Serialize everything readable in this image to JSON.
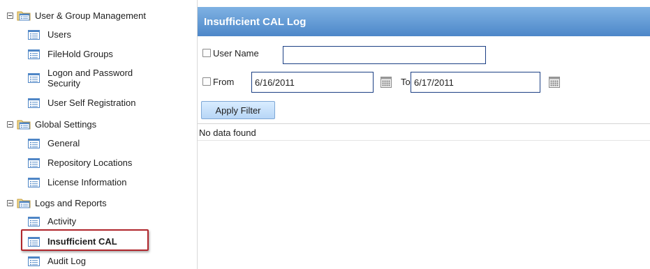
{
  "sidebar": {
    "groups": [
      {
        "label": "User & Group Management",
        "items": [
          {
            "label": "Users"
          },
          {
            "label": "FileHold Groups"
          },
          {
            "label": "Logon and Password Security"
          },
          {
            "label": "User Self Registration"
          }
        ]
      },
      {
        "label": "Global Settings",
        "items": [
          {
            "label": "General"
          },
          {
            "label": "Repository Locations"
          },
          {
            "label": "License Information"
          }
        ]
      },
      {
        "label": "Logs and Reports",
        "items": [
          {
            "label": "Activity"
          },
          {
            "label": "Insufficient CAL",
            "selected": true
          },
          {
            "label": "Audit Log"
          }
        ]
      }
    ],
    "icons": {
      "group": "folder-list-icon",
      "item": "list-document-icon",
      "toggle": "collapse-minus-icon"
    }
  },
  "main": {
    "title": "Insufficient CAL Log",
    "filters": {
      "user_name": {
        "label": "User Name",
        "value": "",
        "checked": false
      },
      "from": {
        "label": "From",
        "value": "6/16/2011",
        "checked": false
      },
      "to": {
        "label": "To",
        "value": "6/17/2011"
      }
    },
    "apply_label": "Apply Filter",
    "empty_message": "No data found"
  },
  "colors": {
    "title_bar_top": "#7fb2e3",
    "title_bar_bottom": "#4d87c9",
    "selection_outline": "#b0262c",
    "input_border": "#1b3f84",
    "button_fill": "#c8e1fb"
  }
}
